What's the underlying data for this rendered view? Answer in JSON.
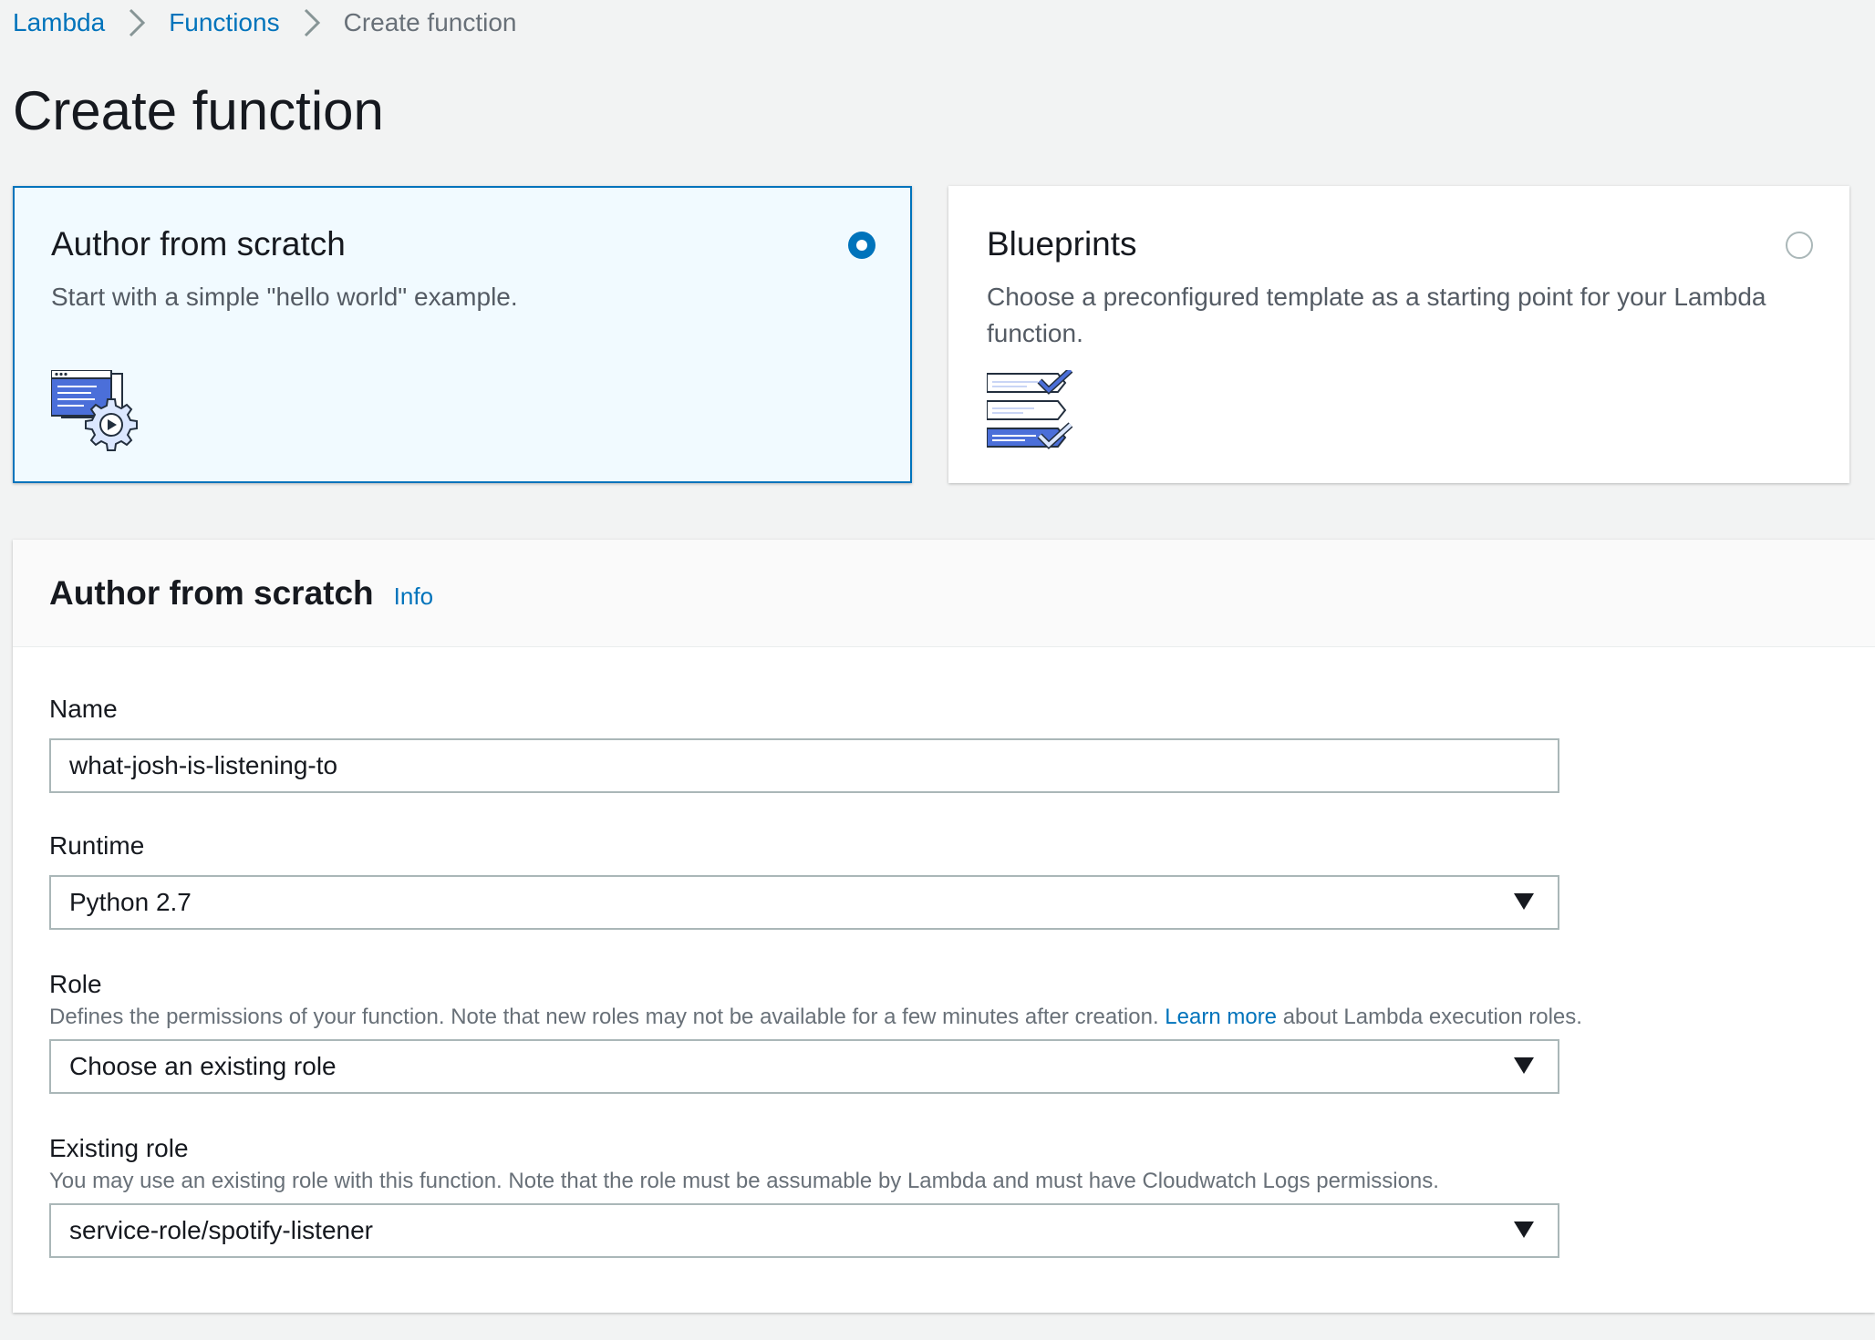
{
  "breadcrumb": {
    "items": [
      {
        "label": "Lambda"
      },
      {
        "label": "Functions"
      },
      {
        "label": "Create function"
      }
    ]
  },
  "page_title": "Create function",
  "options": {
    "author": {
      "title": "Author from scratch",
      "description": "Start with a simple \"hello world\" example.",
      "selected": true,
      "icon": "code-window-gear-icon"
    },
    "blueprints": {
      "title": "Blueprints",
      "description": "Choose a preconfigured template as a starting point for your Lambda function.",
      "selected": false,
      "icon": "checklist-templates-icon"
    }
  },
  "form": {
    "title": "Author from scratch",
    "info_label": "Info",
    "name": {
      "label": "Name",
      "value": "what-josh-is-listening-to"
    },
    "runtime": {
      "label": "Runtime",
      "value": "Python 2.7"
    },
    "role": {
      "label": "Role",
      "description_before": "Defines the permissions of your function. Note that new roles may not be available for a few minutes after creation.",
      "link": "Learn more",
      "description_after": "about Lambda execution roles.",
      "value": "Choose an existing role"
    },
    "existing_role": {
      "label": "Existing role",
      "description": "You may use an existing role with this function. Note that the role must be assumable by Lambda and must have Cloudwatch Logs permissions.",
      "value": "service-role/spotify-listener"
    }
  },
  "colors": {
    "accent": "#0073bb",
    "selected_card_bg": "#f1faff",
    "page_bg": "#f2f3f3"
  }
}
